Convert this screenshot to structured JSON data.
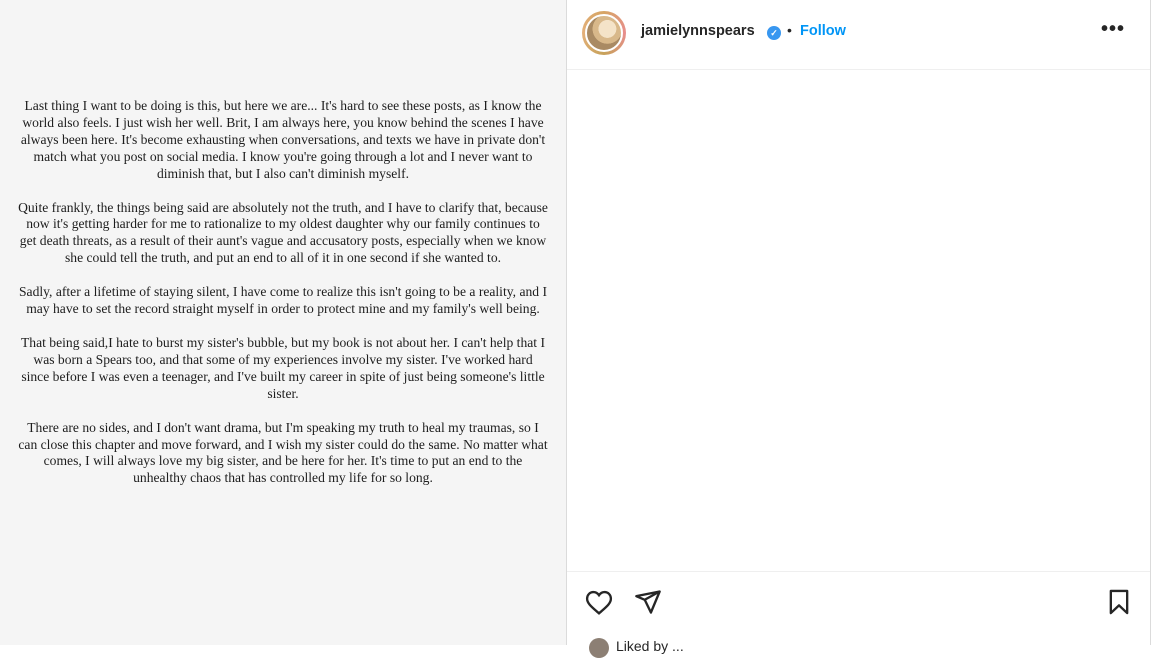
{
  "post": {
    "paragraphs": [
      "Last thing I want to be doing is this, but here we are... It's hard to see these posts, as I know the world also feels. I just wish her well. Brit, I am always here, you know behind the scenes I have always been here. It's become exhausting when conversations, and texts we have in private don't match what you post on social media. I know you're going through a lot and I never want to diminish that, but I also can't diminish myself.",
      "Quite frankly, the things being said are absolutely not the truth, and I have to clarify that, because now it's getting harder for me to rationalize to my oldest daughter why our family continues to get death threats, as a result of their aunt's vague and accusatory posts, especially when we know she could tell the truth, and put an end to all of it in one second if she wanted to.",
      "Sadly, after a lifetime of staying silent, I have come to realize this isn't going to be a reality,  and I may have to set the record straight myself in order to protect mine and my family's well being.",
      "That being said,I hate to burst my sister's bubble, but my book is not about her. I can't help that I was born a Spears too, and that some of my experiences involve my sister. I've worked hard since before I was even a teenager, and I've built my career in spite of just being someone's little sister.",
      "There are no sides, and I don't want drama, but I'm speaking my truth to heal my traumas, so I can close this chapter and move forward, and I wish my sister could do the same. No matter what comes, I will always love my big sister, and be here for her. It's time to put an end to the unhealthy chaos that has controlled my life for so long."
    ]
  },
  "header": {
    "username": "jamielynnspears",
    "separator": "•",
    "follow_label": "Follow",
    "more_label": "•••"
  },
  "likes": {
    "text": "Liked by ..."
  },
  "colors": {
    "accent": "#0095f6",
    "verified": "#3897f0",
    "text": "#262626",
    "border": "#dbdbdb"
  },
  "icons": [
    "heart-icon",
    "share-icon",
    "bookmark-icon",
    "verified-badge-icon",
    "more-options-icon"
  ]
}
